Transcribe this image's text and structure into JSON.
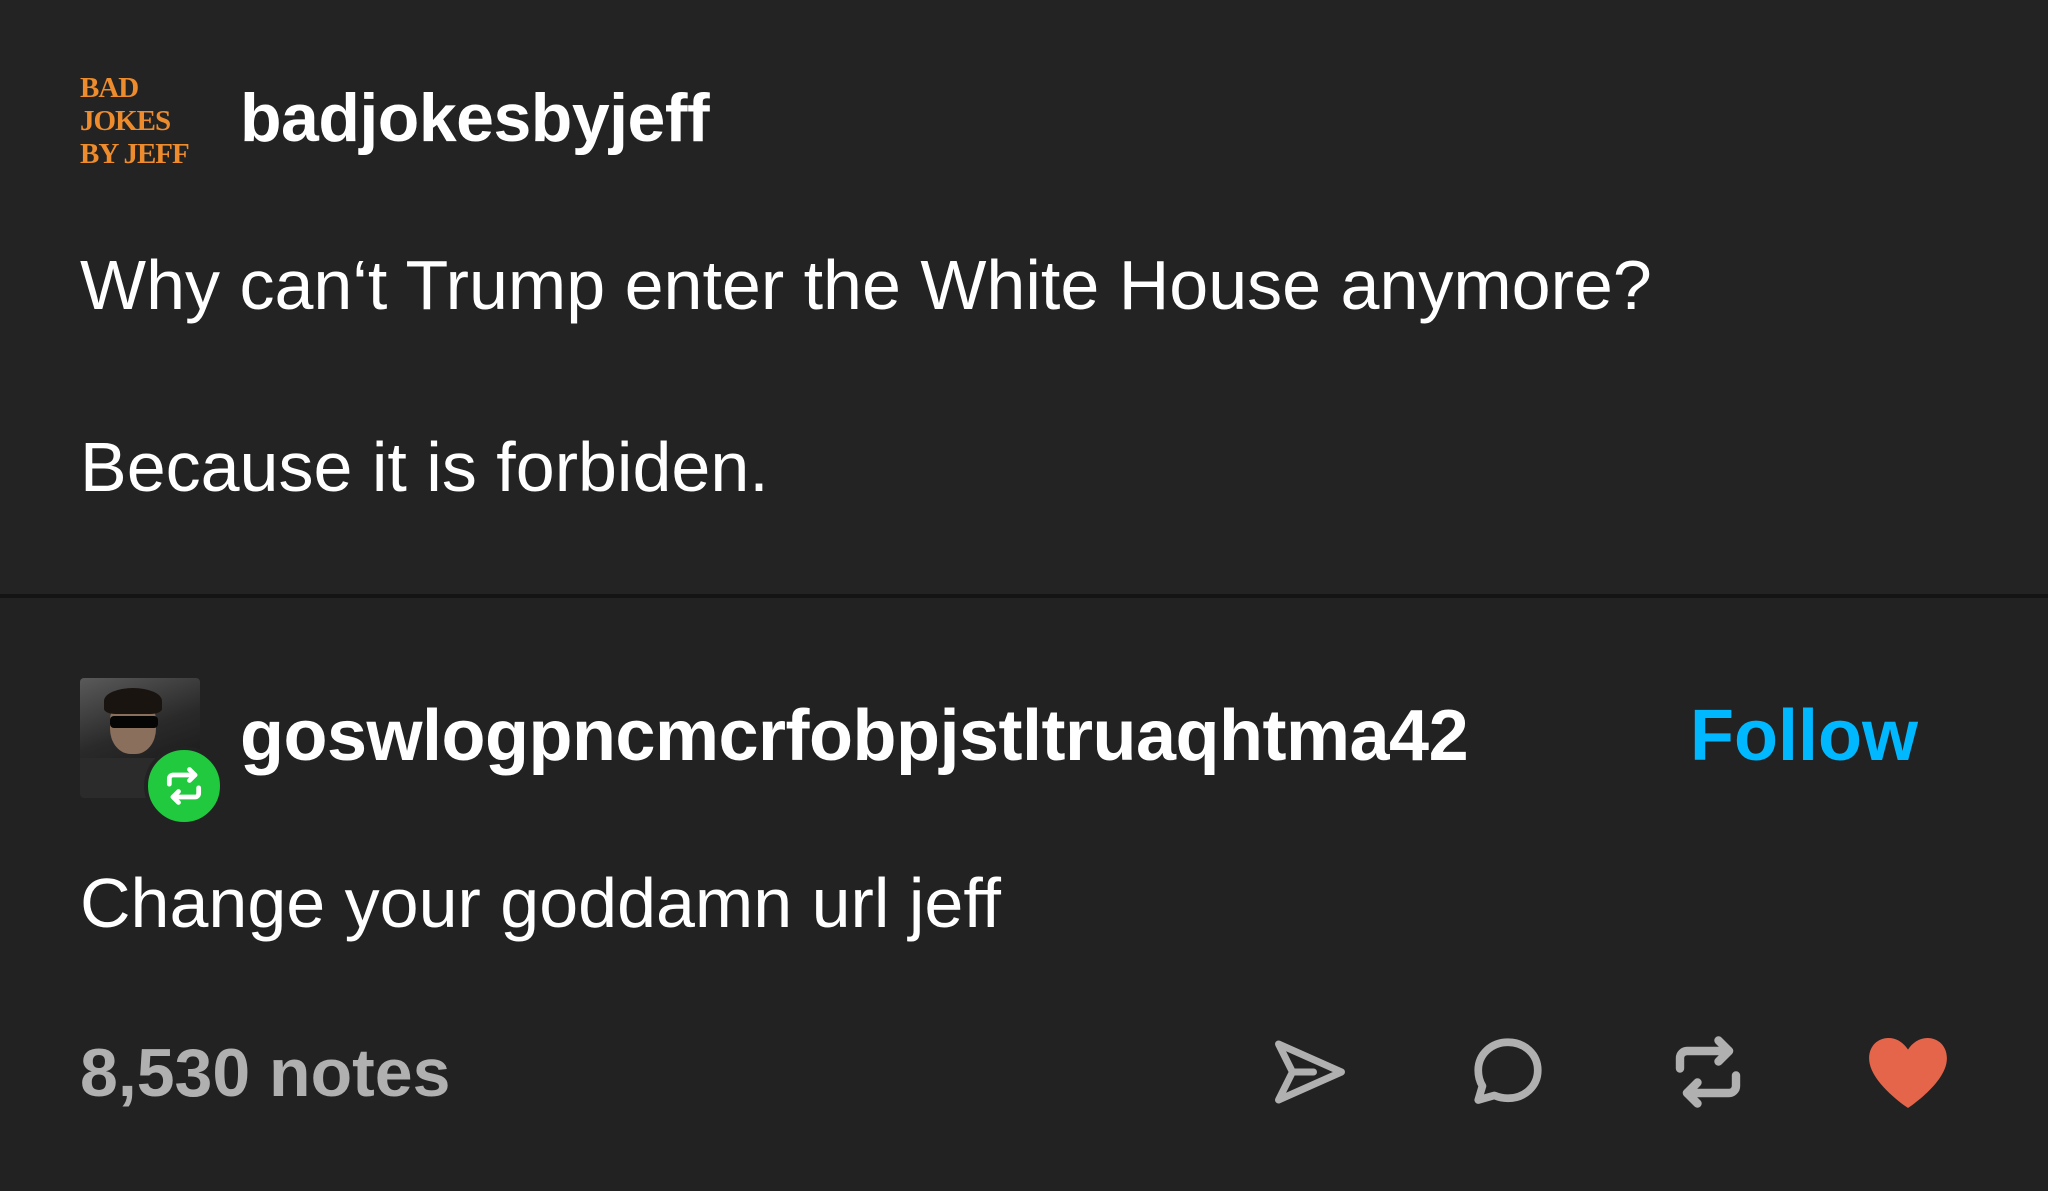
{
  "post": {
    "author": "badjokesbyjeff",
    "logo_lines": [
      "BAD",
      "JOKES",
      "BY JEFF"
    ],
    "question": "Why can‘t Trump enter the White House anymore?",
    "answer": "Because it is forbiden."
  },
  "reblog": {
    "author": "goswlogpncmcrfobpjstltruaqhtma42",
    "follow_label": "Follow",
    "text": "Change your goddamn url jeff"
  },
  "footer": {
    "notes": "8,530 notes"
  },
  "colors": {
    "background": "#222222",
    "logo": "#ee8b2c",
    "follow": "#00b8ff",
    "reblog_badge": "#21c93f",
    "like": "#e5654b",
    "muted": "#b0b0b0"
  },
  "icons": {
    "share": "share-icon",
    "comment": "comment-icon",
    "reblog": "reblog-icon",
    "like": "heart-icon"
  }
}
